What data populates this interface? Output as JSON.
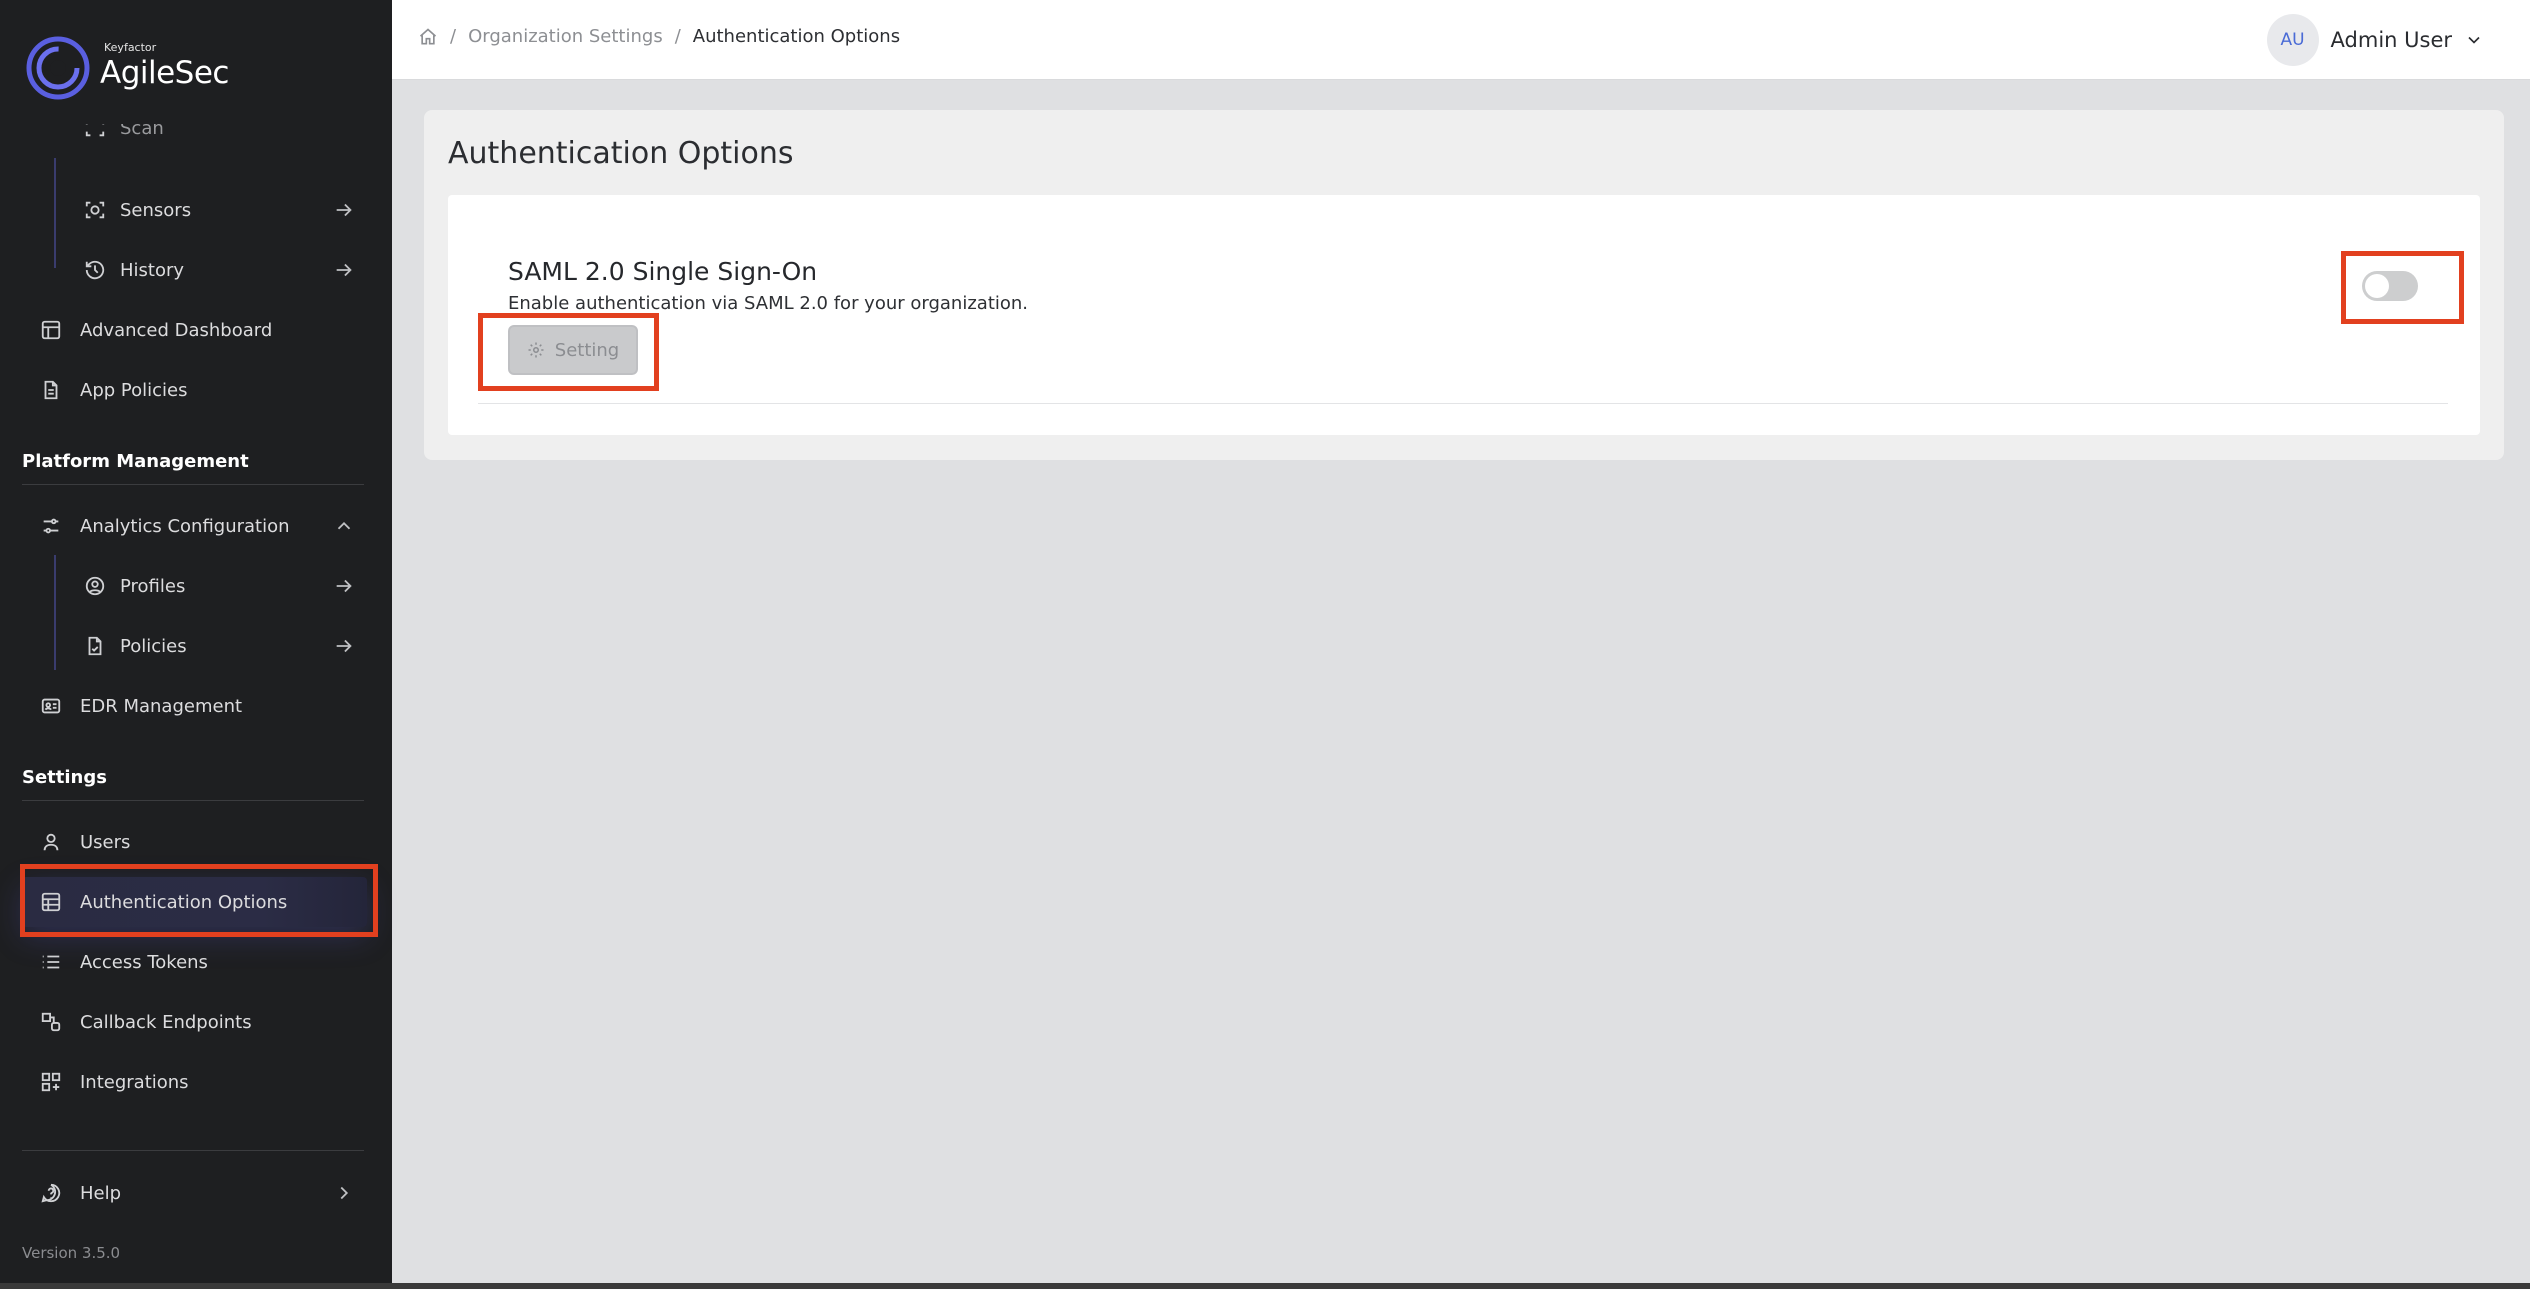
{
  "brand": {
    "small": "Keyfactor",
    "big": "AgileSec"
  },
  "sidebar": {
    "partial_item": "Scan",
    "items": [
      {
        "label": "Sensors",
        "icon": "sensor-icon"
      },
      {
        "label": "History",
        "icon": "history-icon"
      },
      {
        "label": "Advanced Dashboard",
        "icon": "dashboard-icon"
      },
      {
        "label": "App Policies",
        "icon": "document-icon"
      }
    ],
    "platform_title": "Platform Management",
    "platform_items": [
      {
        "label": "Analytics Configuration",
        "icon": "sliders-icon"
      },
      {
        "label": "Profiles",
        "icon": "profile-icon"
      },
      {
        "label": "Policies",
        "icon": "policy-icon"
      },
      {
        "label": "EDR Management",
        "icon": "id-card-icon"
      }
    ],
    "settings_title": "Settings",
    "settings_items": [
      {
        "label": "Users",
        "icon": "user-icon"
      },
      {
        "label": "Authentication Options",
        "icon": "table-icon"
      },
      {
        "label": "Access Tokens",
        "icon": "list-icon"
      },
      {
        "label": "Callback Endpoints",
        "icon": "shapes-icon"
      },
      {
        "label": "Integrations",
        "icon": "integrations-icon"
      }
    ],
    "help": "Help",
    "version": "Version 3.5.0"
  },
  "header": {
    "breadcrumb": [
      "Organization Settings",
      "Authentication Options"
    ],
    "user_initials": "AU",
    "user_name": "Admin User"
  },
  "main": {
    "title": "Authentication Options",
    "option": {
      "title": "SAML 2.0 Single Sign-On",
      "description": "Enable authentication via SAML 2.0 for your organization.",
      "button": "Setting",
      "enabled": false
    }
  },
  "colors": {
    "sidebar_bg": "#1e1f21",
    "highlight": "#e2401f",
    "accent": "#4a4fd6"
  }
}
